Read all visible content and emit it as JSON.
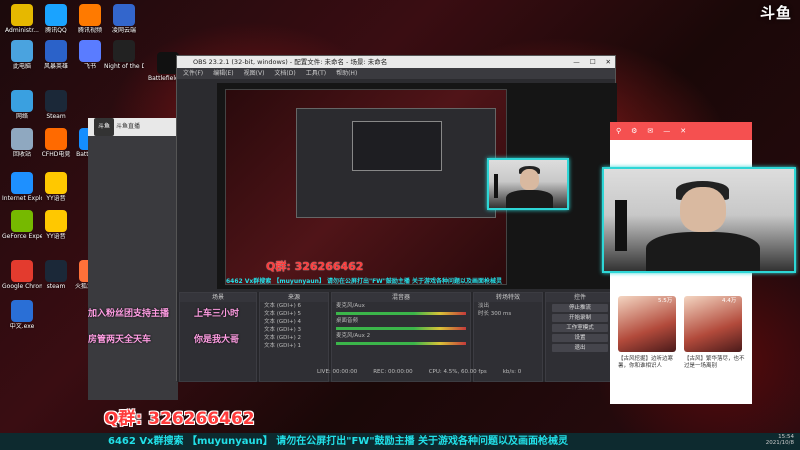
{
  "desktop": {
    "icons": [
      {
        "label": "Administr...",
        "color": "#e6b800"
      },
      {
        "label": "腾讯QQ",
        "color": "#1aa3ff"
      },
      {
        "label": "腾讯视频",
        "color": "#ff7a00"
      },
      {
        "label": "凌网云端",
        "color": "#3366cc"
      },
      {
        "label": "此电脑",
        "color": "#4aa3df"
      },
      {
        "label": "风暴英雄",
        "color": "#2b62c9"
      },
      {
        "label": "飞书",
        "color": "#5a7cff"
      },
      {
        "label": "Night of the Dead",
        "color": "#222222"
      },
      {
        "label": "Battlefield 2042",
        "color": "#111111"
      },
      {
        "label": "网络",
        "color": "#3aa0e0"
      },
      {
        "label": "Steam",
        "color": "#1b2838"
      },
      {
        "label": "回收站",
        "color": "#8fa8c0"
      },
      {
        "label": "CFHD电竞",
        "color": "#ff6a00"
      },
      {
        "label": "Battlenet",
        "color": "#148eff"
      },
      {
        "label": "Internet Explorer",
        "color": "#1e90ff"
      },
      {
        "label": "YY语音",
        "color": "#ffc800"
      },
      {
        "label": "GeForce Experience",
        "color": "#76b900"
      },
      {
        "label": "YY语音",
        "color": "#ffc800"
      },
      {
        "label": "Google Chrome",
        "color": "#e33b2e"
      },
      {
        "label": "steam",
        "color": "#1b2838"
      },
      {
        "label": "火狐浏览器",
        "color": "#ff7139"
      },
      {
        "label": "中文.exe",
        "color": "#2a6fd6"
      }
    ],
    "douyu_logo": "斗鱼"
  },
  "obs": {
    "title": "OBS 23.2.1 (32-bit, windows) - 配置文件: 未命名 - 场景: 未命名",
    "menu": [
      "文件(F)",
      "编辑(E)",
      "视图(V)",
      "文档(D)",
      "工具(T)",
      "帮助(H)"
    ],
    "docks": {
      "scenes": {
        "title": "场景"
      },
      "sources": {
        "title": "来源",
        "items": [
          "文本 (GDI+) 6",
          "文本 (GDI+) 5",
          "文本 (GDI+) 4",
          "文本 (GDI+) 3",
          "文本 (GDI+) 2",
          "文本 (GDI+) 1"
        ]
      },
      "mixer": {
        "title": "混音器",
        "channels": [
          "麦克风/Aux",
          "桌面音频",
          "麦克风/Aux 2"
        ]
      },
      "transitions": {
        "title": "转场特效",
        "selected": "淡出",
        "duration_label": "时长",
        "duration": "300 ms"
      },
      "controls": {
        "title": "控件",
        "buttons": [
          "停止推流",
          "开始录制",
          "工作室模式",
          "设置",
          "退出"
        ]
      }
    },
    "status": [
      "LIVE: 00:00:00",
      "REC: 00:00:00",
      "CPU: 4.5%, 60.00 fps",
      "kb/s: 0"
    ],
    "preview_overlay": {
      "qq_group": "Q群: 326266462",
      "ticker": "6462  Vx群搜索 【muyunyaun】 请勿在公屏打出\"FW\"鼓励主播  关于游戏各种问题以及画面枪械灵"
    }
  },
  "browser": {
    "logo": "斗鱼",
    "tab": "斗鱼直播"
  },
  "right_app": {
    "cards": [
      {
        "caption": "【古风挖掘】边听边寒暑，你和谁相识人"
      },
      {
        "caption": "【古风】繁华落尽，也不过是一场离别"
      }
    ],
    "counts": [
      "5.5万",
      "4.4万"
    ]
  },
  "overlays": {
    "danmu": [
      {
        "text": "加入粉丝团支持主播",
        "color": "#ff9de3"
      },
      {
        "text": "上车三小时",
        "color": "#ff9de3"
      },
      {
        "text": "房管两天全天车",
        "color": "#ff9de3"
      },
      {
        "text": "你是我大哥",
        "color": "#ff9de3"
      }
    ],
    "qq_group_big": "Q群: 326266462",
    "ticker": "6462   Vx群搜索 【muyunyaun】 请勿在公屏打出\"FW\"鼓励主播  关于游戏各种问题以及画面枪械灵"
  },
  "taskbar": {
    "time": "15:54",
    "date": "2021/10/8"
  },
  "colors": {
    "accent_cyan": "#2ed6d6",
    "qq_red": "#ff3b3b",
    "danmu_pink": "#ff9de3"
  }
}
